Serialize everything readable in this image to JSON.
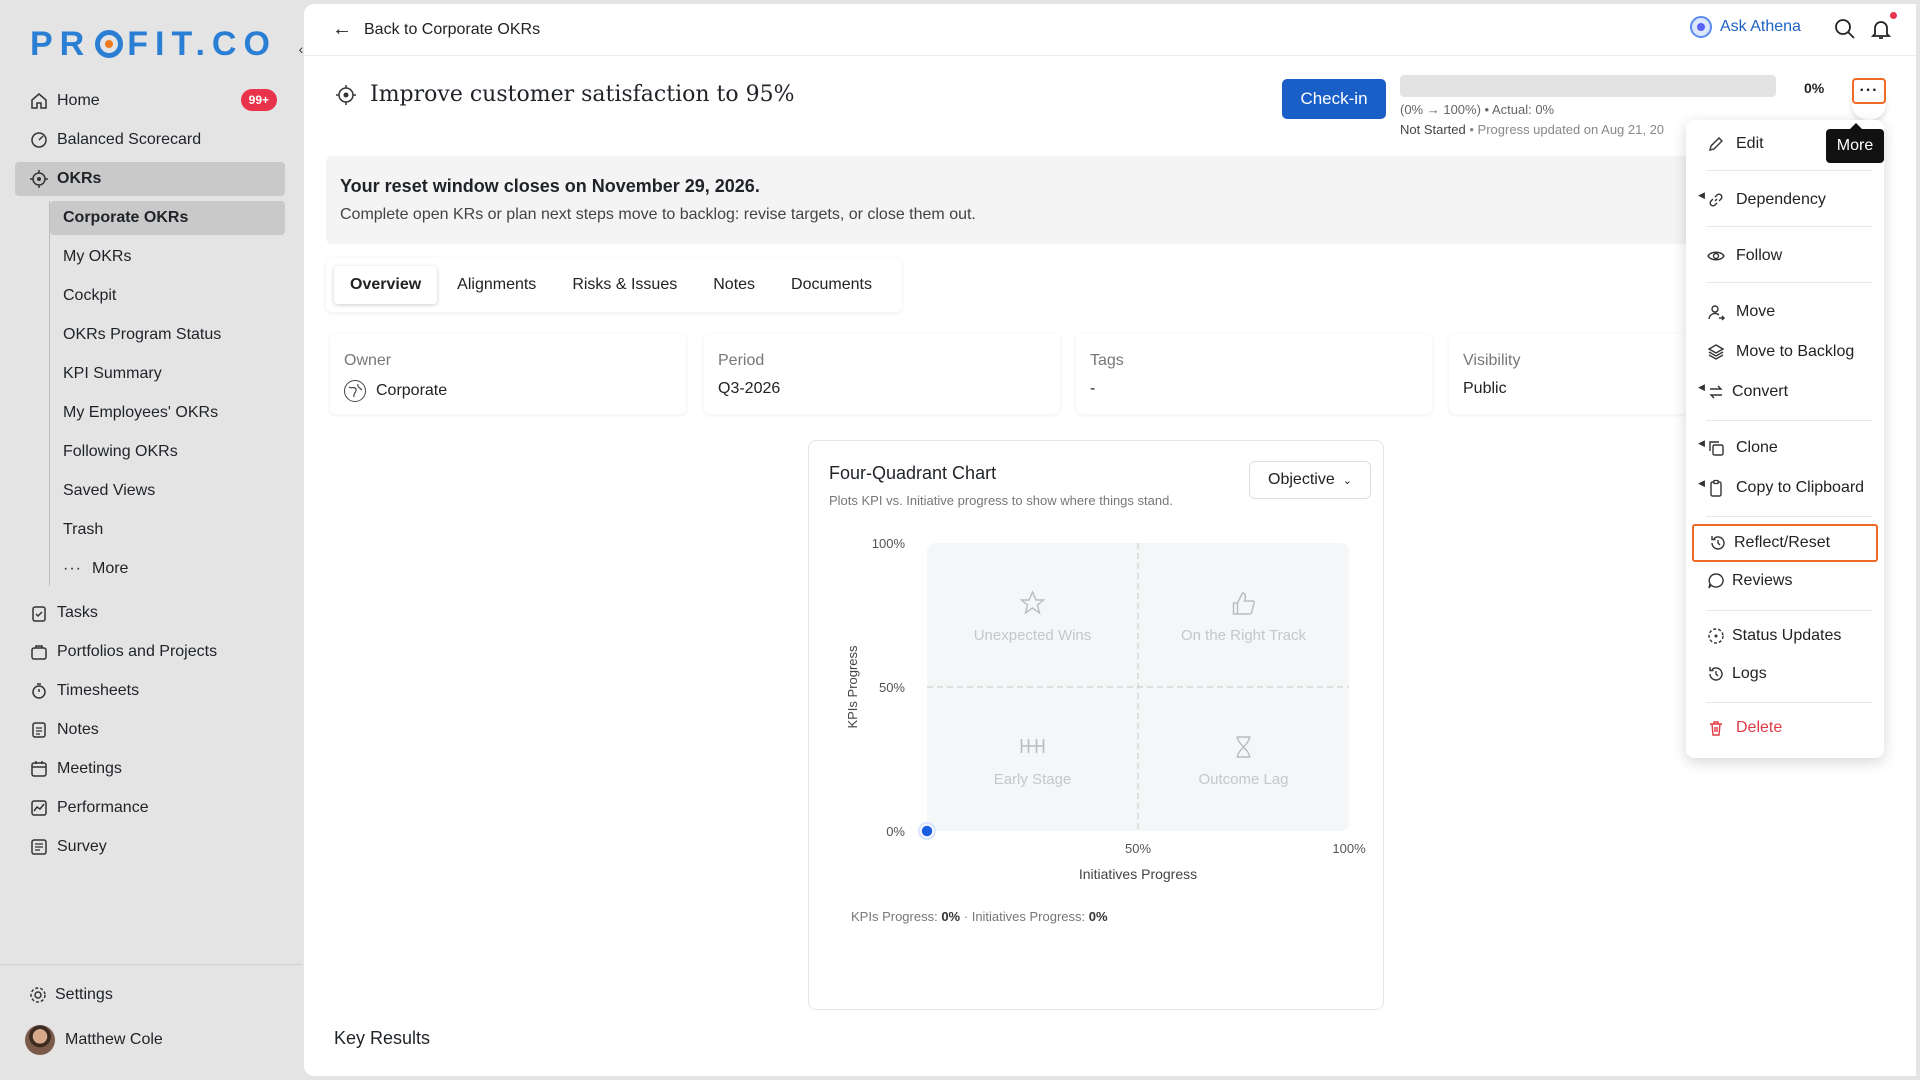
{
  "brand": {
    "logo_text_a": "PR",
    "logo_text_b": "FIT.CO"
  },
  "sidebar": {
    "home": {
      "label": "Home",
      "badge": "99+"
    },
    "balanced": "Balanced Scorecard",
    "okrs": "OKRs",
    "okr_sub": [
      "Corporate OKRs",
      "My OKRs",
      "Cockpit",
      "OKRs Program Status",
      "KPI Summary",
      "My Employees' OKRs",
      "Following OKRs",
      "Saved Views",
      "Trash"
    ],
    "okr_more": "More",
    "items": [
      "Tasks",
      "Portfolios and Projects",
      "Timesheets",
      "Notes",
      "Meetings",
      "Performance",
      "Survey"
    ],
    "settings": "Settings",
    "user": "Matthew Cole"
  },
  "topbar": {
    "back": "Back to Corporate OKRs",
    "athena": "Ask Athena"
  },
  "objective": {
    "title": "Improve customer satisfaction to 95%",
    "checkin": "Check-in",
    "progress": 0,
    "progress_pct": "0%",
    "progress_sub1": "(0% → 100%) • Actual: 0%",
    "status": "Not Started",
    "updated": "• Progress updated on Aug 21, 20"
  },
  "banner": {
    "title": "Your reset window closes on November 29, 2026.",
    "text": "Complete open KRs or plan next steps move to backlog: revise targets, or close them out."
  },
  "tabs": [
    "Overview",
    "Alignments",
    "Risks & Issues",
    "Notes",
    "Documents"
  ],
  "info": {
    "owner_label": "Owner",
    "owner": "Corporate",
    "period_label": "Period",
    "period": "Q3-2026",
    "tags_label": "Tags",
    "tags": "-",
    "visibility_label": "Visibility",
    "visibility": "Public"
  },
  "chart": {
    "title": "Four-Quadrant Chart",
    "subtitle": "Plots KPI vs. Initiative progress to show where things stand.",
    "select": "Objective",
    "footer_kpi_label": "KPIs Progress:",
    "footer_kpi": "0%",
    "footer_init_label": "Initiatives Progress:",
    "footer_init": "0%"
  },
  "chart_data": {
    "type": "scatter",
    "xlabel": "Initiatives Progress",
    "ylabel": "KPIs Progress",
    "xlim": [
      0,
      100
    ],
    "ylim": [
      0,
      100
    ],
    "x_ticks": [
      "50%",
      "100%"
    ],
    "y_ticks": [
      "0%",
      "50%",
      "100%"
    ],
    "quadrants": [
      "Unexpected Wins",
      "On the Right Track",
      "Early Stage",
      "Outcome Lag"
    ],
    "points": [
      {
        "x": 0,
        "y": 0
      }
    ],
    "colors": {
      "point": "#1a5fe0"
    }
  },
  "key_results": "Key Results",
  "menu": {
    "edit": "Edit",
    "dependency": "Dependency",
    "follow": "Follow",
    "move": "Move",
    "move_backlog": "Move to Backlog",
    "convert": "Convert",
    "clone": "Clone",
    "copy": "Copy to Clipboard",
    "reflect": "Reflect/Reset",
    "reviews": "Reviews",
    "status_updates": "Status Updates",
    "logs": "Logs",
    "delete": "Delete"
  },
  "tooltip": "More",
  "colors": {
    "accent": "#1a5fc8",
    "highlight": "#ef6b23",
    "danger": "#e13b47",
    "badge": "#e8334a"
  }
}
